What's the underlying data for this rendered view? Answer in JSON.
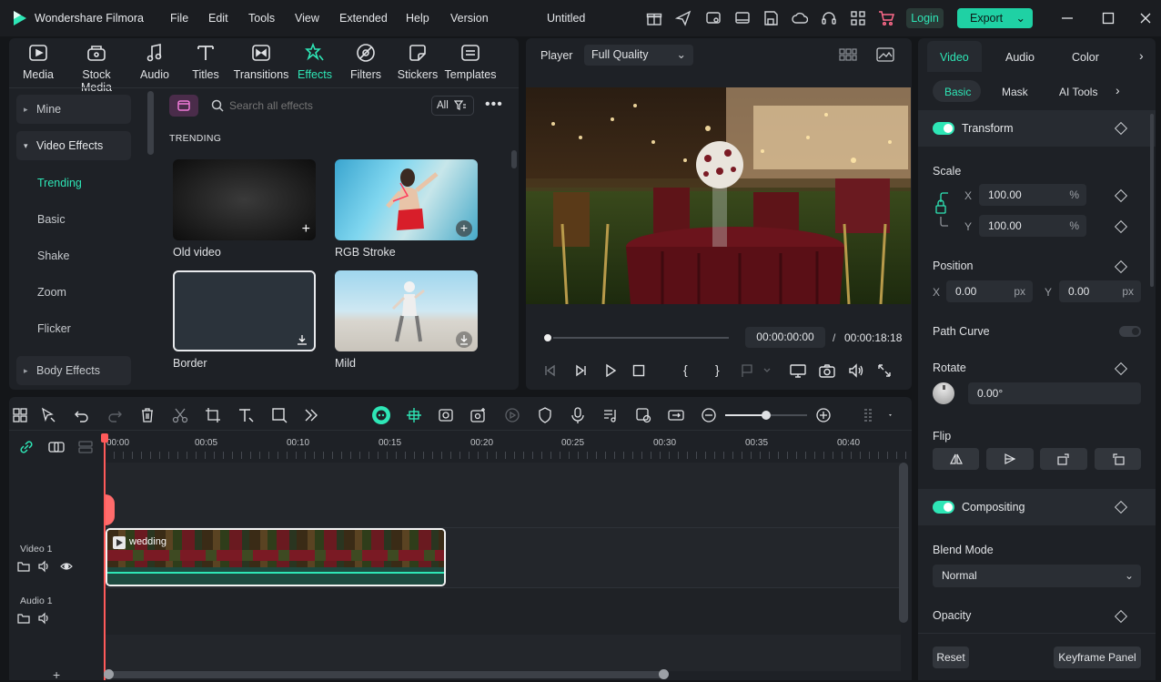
{
  "app": {
    "title": "Wondershare Filmora",
    "project": "Untitled"
  },
  "menu": [
    "File",
    "Edit",
    "Tools",
    "View",
    "Extended",
    "Help",
    "Version"
  ],
  "header": {
    "login": "Login",
    "export": "Export"
  },
  "library": {
    "categories": [
      {
        "label": "Media",
        "icon": "media-icon"
      },
      {
        "label": "Stock Media",
        "icon": "stock-media-icon"
      },
      {
        "label": "Audio",
        "icon": "audio-icon"
      },
      {
        "label": "Titles",
        "icon": "titles-icon"
      },
      {
        "label": "Transitions",
        "icon": "transitions-icon"
      },
      {
        "label": "Effects",
        "icon": "effects-icon"
      },
      {
        "label": "Filters",
        "icon": "filters-icon"
      },
      {
        "label": "Stickers",
        "icon": "stickers-icon"
      },
      {
        "label": "Templates",
        "icon": "templates-icon"
      }
    ],
    "sidebar": {
      "mine": "Mine",
      "video_effects": "Video Effects",
      "subs": [
        "Trending",
        "Basic",
        "Shake",
        "Zoom",
        "Flicker"
      ],
      "body_effects": "Body Effects"
    },
    "search_placeholder": "Search all effects",
    "filter": "All",
    "section": "TRENDING",
    "effects": [
      "Old video",
      "RGB Stroke",
      "Border",
      "Mild"
    ]
  },
  "player": {
    "label": "Player",
    "quality": "Full Quality",
    "current": "00:00:00:00",
    "sep": "/",
    "total": "00:00:18:18"
  },
  "timeline": {
    "ruler": [
      "00:00",
      "00:05",
      "00:10",
      "00:15",
      "00:20",
      "00:25",
      "00:30",
      "00:35",
      "00:40"
    ],
    "tracks": {
      "video": "Video 1",
      "audio": "Audio 1"
    },
    "clip": "wedding",
    "add": "+"
  },
  "props": {
    "tabs": [
      "Video",
      "Audio",
      "Color"
    ],
    "subtabs": [
      "Basic",
      "Mask",
      "AI Tools"
    ],
    "transform": "Transform",
    "scale": {
      "label": "Scale",
      "x_label": "X",
      "x": "100.00",
      "y_label": "Y",
      "y": "100.00",
      "unit": "%"
    },
    "position": {
      "label": "Position",
      "x_label": "X",
      "x": "0.00",
      "y_label": "Y",
      "y": "0.00",
      "unit": "px"
    },
    "path_curve": "Path Curve",
    "rotate": {
      "label": "Rotate",
      "value": "0.00°"
    },
    "flip": "Flip",
    "compositing": "Compositing",
    "blend": {
      "label": "Blend Mode",
      "value": "Normal"
    },
    "opacity": "Opacity",
    "reset": "Reset",
    "keyframe": "Keyframe Panel"
  },
  "colors": {
    "accent": "#2ee6b6",
    "export": "#1fd1a4",
    "playhead": "#ff5a5a"
  }
}
